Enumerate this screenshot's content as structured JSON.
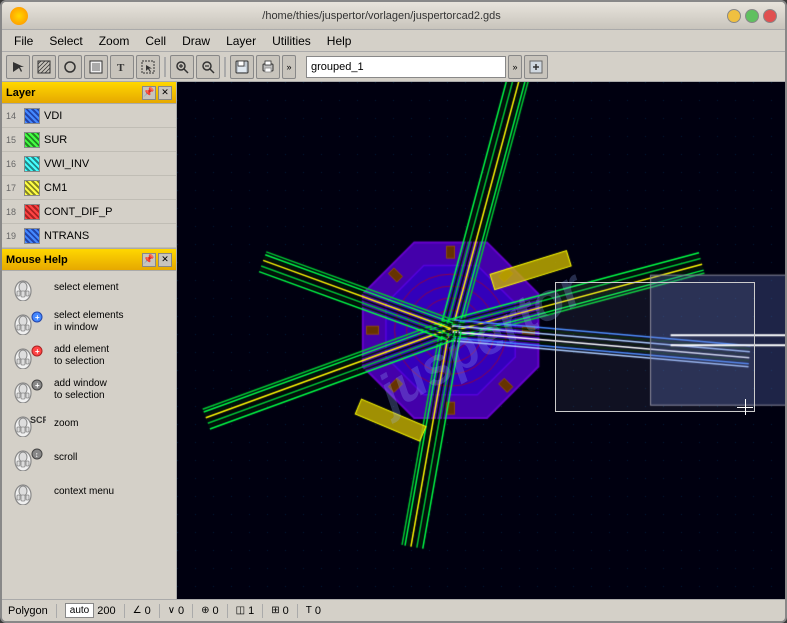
{
  "window": {
    "title": "/home/thies/juspertor/vorlagen/juspertorcad2.gds",
    "icon": "app-icon"
  },
  "menu": {
    "items": [
      "File",
      "Select",
      "Zoom",
      "Cell",
      "Draw",
      "Layer",
      "Utilities",
      "Help"
    ]
  },
  "toolbar": {
    "combo_value": "grouped_1",
    "combo_placeholder": "grouped_1",
    "expand_label": "»",
    "expand_label2": "»"
  },
  "layers": {
    "panel_title": "Layer",
    "items": [
      {
        "num": "14",
        "name": "VDI",
        "color_class": "layer-stripe-blue"
      },
      {
        "num": "15",
        "name": "SUR",
        "color_class": "layer-stripe-green"
      },
      {
        "num": "16",
        "name": "VWI_INV",
        "color_class": "layer-stripe-cyan"
      },
      {
        "num": "17",
        "name": "CM1",
        "color_class": "layer-stripe-yellow"
      },
      {
        "num": "18",
        "name": "CONT_DIF_P",
        "color_class": "layer-stripe-red"
      },
      {
        "num": "19",
        "name": "NTRANS",
        "color_class": "layer-stripe-blue"
      }
    ]
  },
  "mouse_help": {
    "panel_title": "Mouse Help",
    "items": [
      {
        "id": "select-element",
        "text": "select element"
      },
      {
        "id": "select-elements-window",
        "text": "select elements\nin window"
      },
      {
        "id": "add-element-selection",
        "text": "add element\nto selection"
      },
      {
        "id": "add-window-selection",
        "text": "add window\nto selection"
      },
      {
        "id": "zoom",
        "text": "zoom"
      },
      {
        "id": "scroll",
        "text": "scroll"
      },
      {
        "id": "context-menu",
        "text": "context menu"
      }
    ]
  },
  "status_bar": {
    "mode": "Polygon",
    "scale_label": "auto",
    "scale_value": "200",
    "coords": [
      {
        "icon": "angle-icon",
        "value": "0"
      },
      {
        "icon": "angle-icon2",
        "value": "0"
      },
      {
        "icon": "coord-icon",
        "value": "0"
      },
      {
        "icon": "layer-icon",
        "value": "1"
      },
      {
        "icon": "space-icon",
        "value": "0"
      },
      {
        "icon": "font-icon",
        "value": "0"
      }
    ]
  },
  "watermark": "juspertor"
}
